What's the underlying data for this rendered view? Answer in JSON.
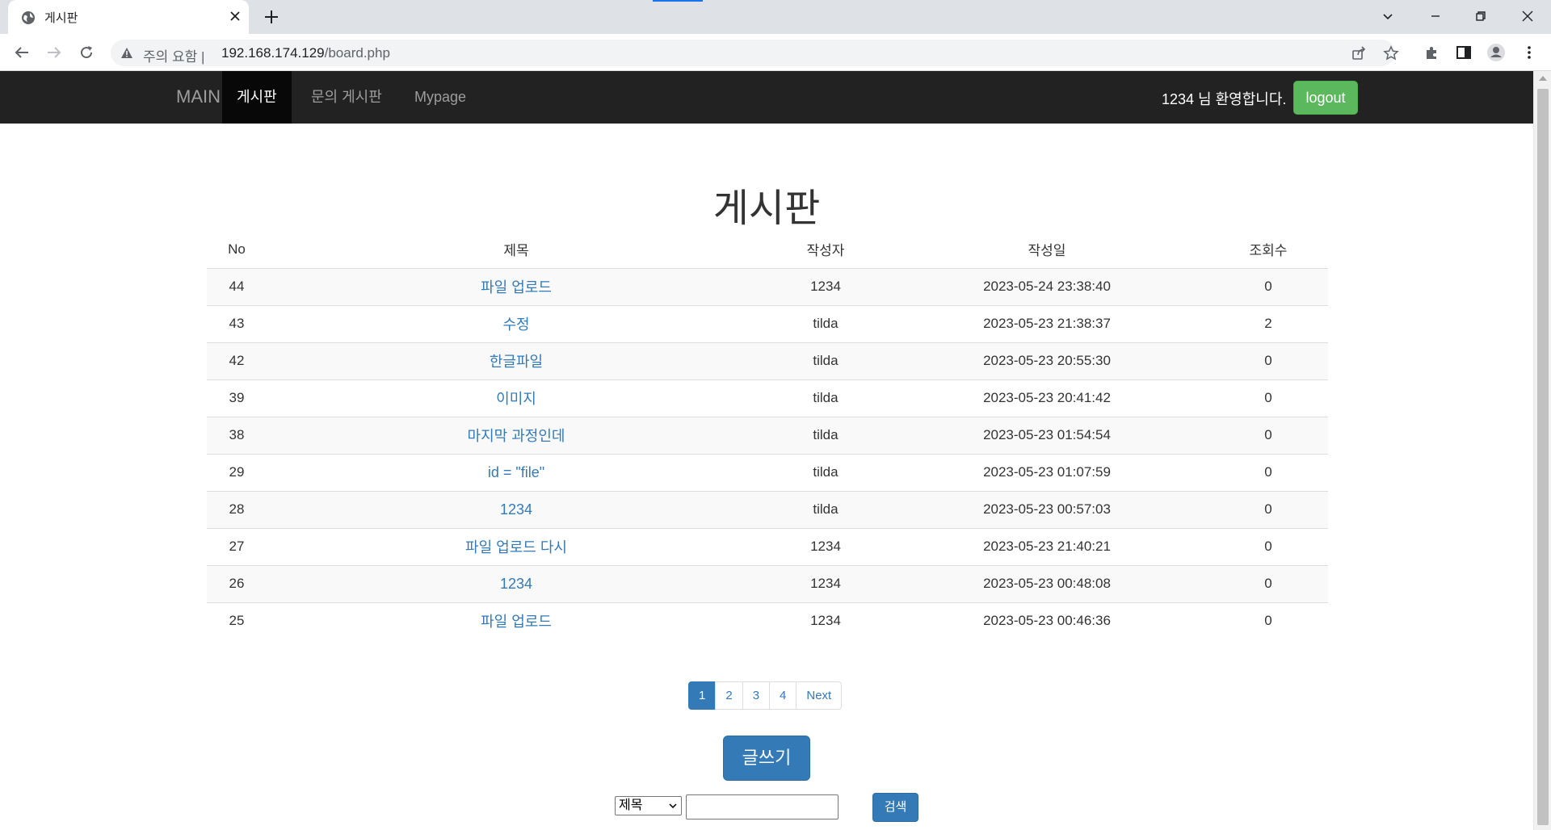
{
  "browser": {
    "tab_title": "게시판",
    "warning_label": "주의 요함",
    "url_host": "192.168.174.129",
    "url_path": "/board.php"
  },
  "navbar": {
    "brand": "MAIN",
    "items": [
      {
        "label": "게시판",
        "active": true
      },
      {
        "label": "문의 게시판",
        "active": false
      },
      {
        "label": "Mypage",
        "active": false
      }
    ],
    "welcome": "1234 님 환영합니다.",
    "logout_label": "logout"
  },
  "board": {
    "title": "게시판",
    "headers": [
      "No",
      "제목",
      "작성자",
      "작성일",
      "조회수"
    ],
    "rows": [
      {
        "no": "44",
        "title": "파일 업로드",
        "writer": "1234",
        "date": "2023-05-24 23:38:40",
        "views": "0"
      },
      {
        "no": "43",
        "title": "수정",
        "writer": "tilda",
        "date": "2023-05-23 21:38:37",
        "views": "2"
      },
      {
        "no": "42",
        "title": "한글파일",
        "writer": "tilda",
        "date": "2023-05-23 20:55:30",
        "views": "0"
      },
      {
        "no": "39",
        "title": "이미지",
        "writer": "tilda",
        "date": "2023-05-23 20:41:42",
        "views": "0"
      },
      {
        "no": "38",
        "title": "마지막 과정인데",
        "writer": "tilda",
        "date": "2023-05-23 01:54:54",
        "views": "0"
      },
      {
        "no": "29",
        "title": "id = \"file\"",
        "writer": "tilda",
        "date": "2023-05-23 01:07:59",
        "views": "0"
      },
      {
        "no": "28",
        "title": "1234",
        "writer": "tilda",
        "date": "2023-05-23 00:57:03",
        "views": "0"
      },
      {
        "no": "27",
        "title": "파일 업로드 다시",
        "writer": "1234",
        "date": "2023-05-23 21:40:21",
        "views": "0"
      },
      {
        "no": "26",
        "title": "1234",
        "writer": "1234",
        "date": "2023-05-23 00:48:08",
        "views": "0"
      },
      {
        "no": "25",
        "title": "파일 업로드",
        "writer": "1234",
        "date": "2023-05-23 00:46:36",
        "views": "0"
      }
    ]
  },
  "pagination": {
    "pages": [
      "1",
      "2",
      "3",
      "4"
    ],
    "current": "1",
    "next_label": "Next"
  },
  "write_label": "글쓰기",
  "search": {
    "selected_option": "제목",
    "query": "",
    "button_label": "검색"
  },
  "colors": {
    "primary": "#337ab7",
    "success": "#5cb85c",
    "navbar_bg": "#222222"
  }
}
